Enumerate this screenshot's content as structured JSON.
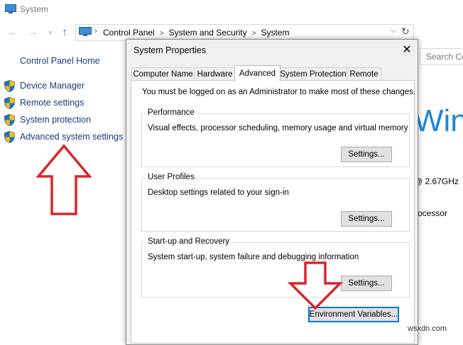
{
  "background_window": {
    "title": "System",
    "breadcrumb": [
      "Control Panel",
      "System and Security",
      "System"
    ],
    "search_placeholder": "Search Co",
    "sidebar": {
      "home": "Control Panel Home",
      "links": [
        "Device Manager",
        "Remote settings",
        "System protection",
        "Advanced system settings"
      ]
    },
    "right_content": {
      "windows_text": "Win",
      "cpu_speed": "@ 2.67GHz",
      "processor": "rocessor"
    }
  },
  "dialog": {
    "title": "System Properties",
    "tabs": [
      "Computer Name",
      "Hardware",
      "Advanced",
      "System Protection",
      "Remote"
    ],
    "active_tab": "Advanced",
    "notice": "You must be logged on as an Administrator to make most of these changes.",
    "groups": [
      {
        "title": "Performance",
        "description": "Visual effects, processor scheduling, memory usage and virtual memory",
        "button": "Settings..."
      },
      {
        "title": "User Profiles",
        "description": "Desktop settings related to your sign-in",
        "button": "Settings..."
      },
      {
        "title": "Start-up and Recovery",
        "description": "System start-up, system failure and debugging information",
        "button": "Settings..."
      }
    ],
    "env_button": "Environment Variables..."
  },
  "watermark": "wsxdn.com",
  "colors": {
    "link": "#1a3a78",
    "accent": "#1e86d6",
    "arrow": "#d9262b"
  }
}
